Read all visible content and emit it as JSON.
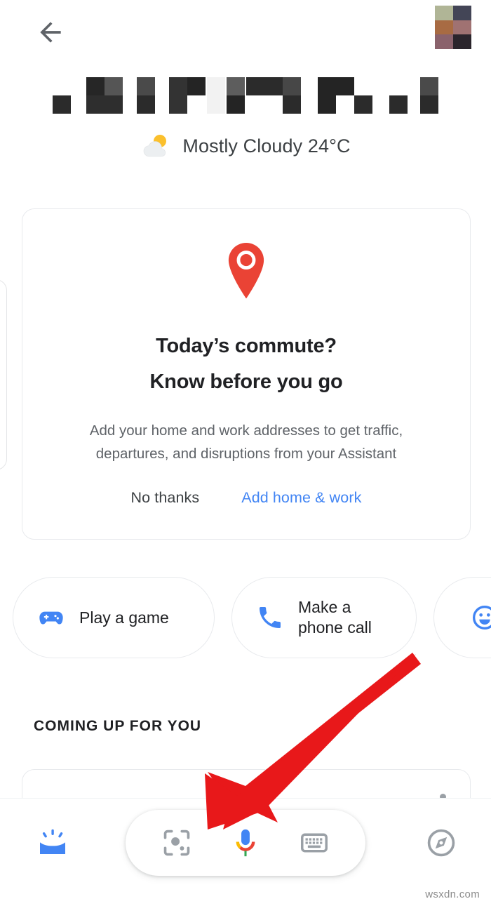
{
  "topbar": {
    "back_icon": "arrow-back-icon",
    "back_label": "Back",
    "avatar_label": "Account avatar",
    "avatar_colors": [
      "#b0b596",
      "#434556",
      "#a86b43",
      "#a07272",
      "#8a626c",
      "#2b252c"
    ]
  },
  "greeting": {
    "redacted": true,
    "label": "Redacted greeting",
    "block_colors": {
      "dark": "#2b2b2b",
      "mid": "#4a4a4a",
      "light_mid": "#5d5d5d",
      "pale": "#f2f2f2"
    }
  },
  "weather": {
    "icon": "partly-cloudy-icon",
    "text": "Mostly Cloudy 24°C",
    "condition": "Mostly Cloudy",
    "temperature": "24°C"
  },
  "commute_card": {
    "icon": "map-pin-icon",
    "title_line1": "Today’s commute?",
    "title_line2": "Know before you go",
    "description_line1": "Add your home and work addresses to get traffic,",
    "description_line2": "departures, and disruptions from your Assistant",
    "secondary_action": "No thanks",
    "primary_action": "Add home & work",
    "primary_color": "#4285f4"
  },
  "chips": [
    {
      "label_line1": "Play a game",
      "label_line2": "",
      "icon": "gamepad-icon",
      "icon_color": "#4285f4"
    },
    {
      "label_line1": "Make a",
      "label_line2": "phone call",
      "icon": "phone-icon",
      "icon_color": "#4285f4"
    },
    {
      "label_line1": "",
      "label_line2": "",
      "icon": "smiley-face-icon",
      "icon_color": "#4285f4"
    }
  ],
  "section": {
    "coming_up_title": "COMING UP FOR YOU"
  },
  "bottom_bar": {
    "left_nav": {
      "icon": "discover-snapshot-icon",
      "label": "Snapshot",
      "color": "#4285f4"
    },
    "right_nav": {
      "icon": "compass-explore-icon",
      "label": "Explore",
      "color": "#9aa0a6"
    },
    "pill": [
      {
        "icon": "google-lens-icon",
        "label": "Google Lens",
        "color": "#9aa0a6"
      },
      {
        "icon": "google-mic-icon",
        "label": "Voice search",
        "color": "#4285f4"
      },
      {
        "icon": "keyboard-icon",
        "label": "Keyboard",
        "color": "#9aa0a6"
      }
    ]
  },
  "annotation": {
    "arrow": "red-arrow-pointing-to-lens",
    "color": "#e8181a",
    "points_at": "google-lens-icon"
  },
  "watermark": {
    "text": "wsxdn.com"
  }
}
